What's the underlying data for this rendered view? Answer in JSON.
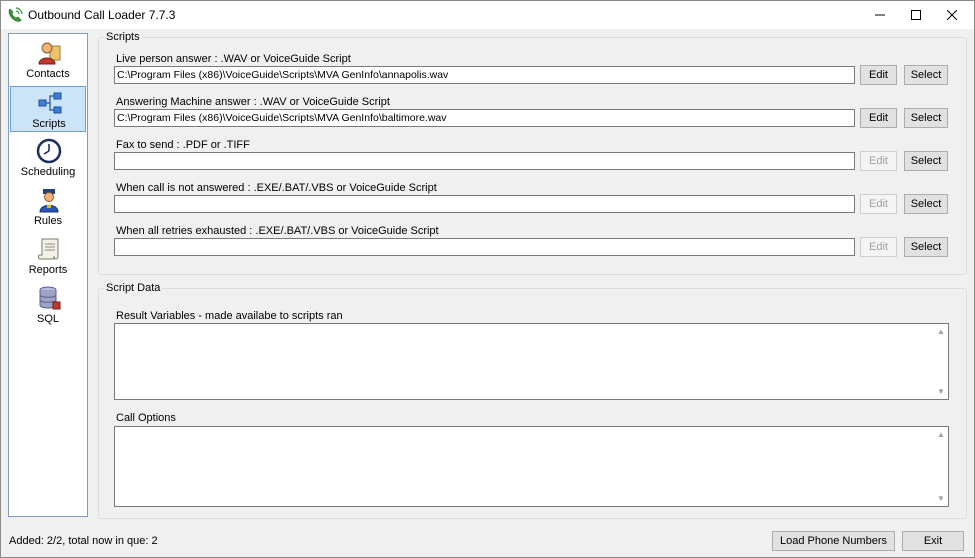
{
  "window": {
    "title": "Outbound Call Loader 7.7.3"
  },
  "nav": {
    "items": [
      {
        "label": "Contacts",
        "icon": "contacts-icon"
      },
      {
        "label": "Scripts",
        "icon": "scripts-icon",
        "selected": true
      },
      {
        "label": "Scheduling",
        "icon": "scheduling-icon"
      },
      {
        "label": "Rules",
        "icon": "rules-icon"
      },
      {
        "label": "Reports",
        "icon": "reports-icon"
      },
      {
        "label": "SQL",
        "icon": "sql-icon"
      }
    ]
  },
  "scripts": {
    "group_title": "Scripts",
    "fields": [
      {
        "label": "Live person answer : .WAV or VoiceGuide Script",
        "value": "C:\\Program Files (x86)\\VoiceGuide\\Scripts\\MVA GenInfo\\annapolis.wav",
        "edit": "Edit",
        "select": "Select",
        "edit_enabled": true
      },
      {
        "label": "Answering Machine answer : .WAV or VoiceGuide Script",
        "value": "C:\\Program Files (x86)\\VoiceGuide\\Scripts\\MVA GenInfo\\baltimore.wav",
        "edit": "Edit",
        "select": "Select",
        "edit_enabled": true
      },
      {
        "label": "Fax to send : .PDF or .TIFF",
        "value": "",
        "edit": "Edit",
        "select": "Select",
        "edit_enabled": false
      },
      {
        "label": "When call is not answered : .EXE/.BAT/.VBS or VoiceGuide Script",
        "value": "",
        "edit": "Edit",
        "select": "Select",
        "edit_enabled": false
      },
      {
        "label": "When all retries exhausted : .EXE/.BAT/.VBS or VoiceGuide Script",
        "value": "",
        "edit": "Edit",
        "select": "Select",
        "edit_enabled": false
      }
    ]
  },
  "script_data": {
    "group_title": "Script Data",
    "result_variables_label": "Result Variables - made availabe to scripts ran",
    "result_variables_value": "",
    "call_options_label": "Call Options",
    "call_options_value": ""
  },
  "footer": {
    "status": "Added: 2/2, total now in que: 2",
    "load_button": "Load Phone Numbers",
    "exit_button": "Exit"
  }
}
